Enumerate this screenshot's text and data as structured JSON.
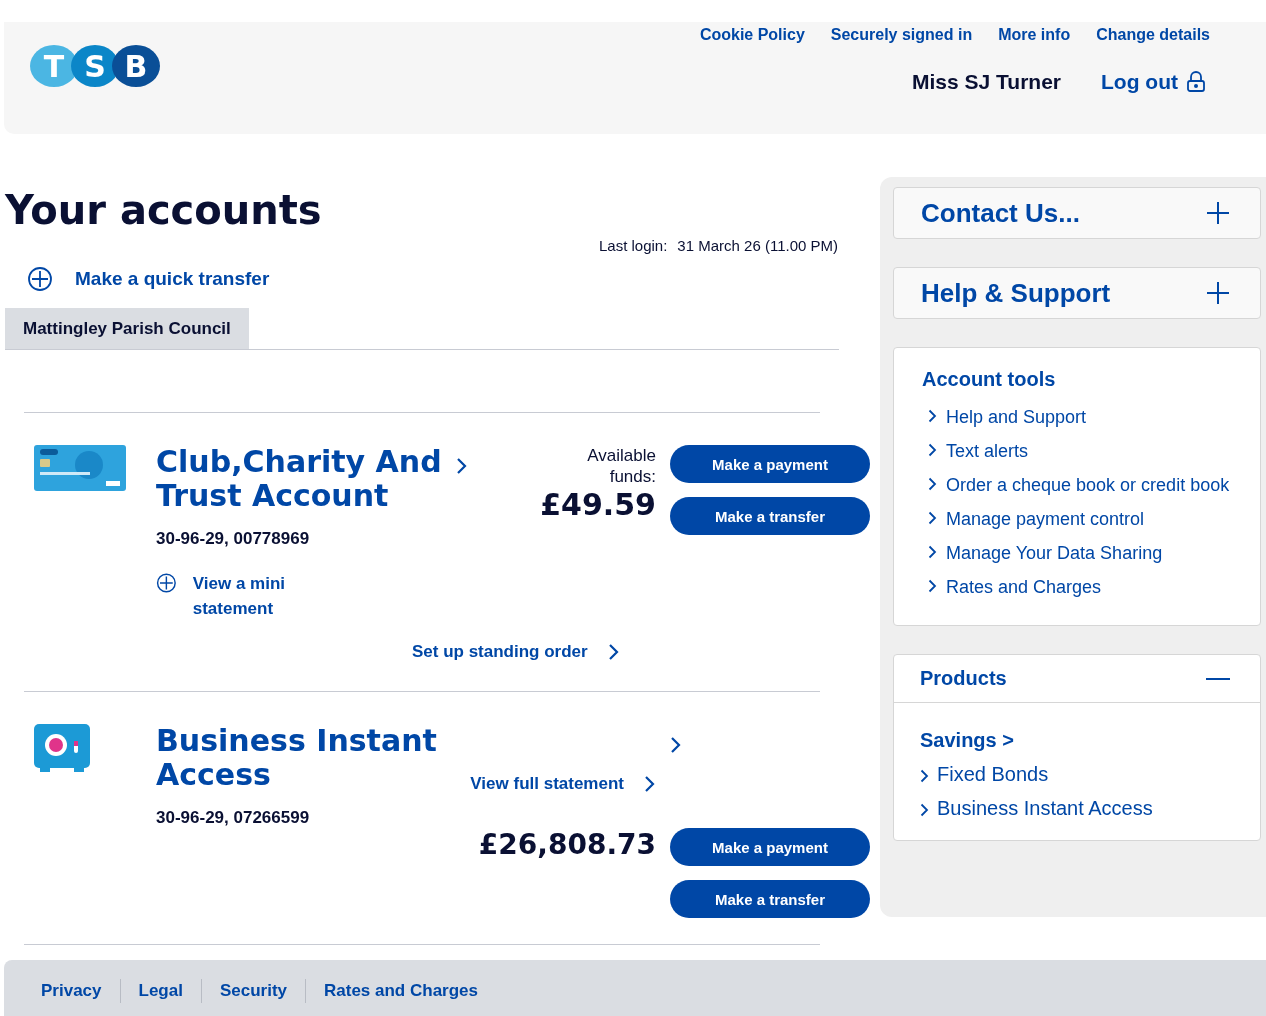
{
  "header": {
    "logo": [
      "T",
      "S",
      "B"
    ],
    "links": [
      "Cookie Policy",
      "Securely signed in",
      "More info",
      "Change details"
    ],
    "user": "Miss SJ Turner",
    "logout": "Log out"
  },
  "title": "Your accounts",
  "last_login": {
    "label": "Last login:",
    "value": "31 March 26 (11.00 PM)"
  },
  "quick_transfer": "Make a quick transfer",
  "tabs": [
    {
      "label": "Mattingley Parish Council",
      "selected": true
    }
  ],
  "accounts": [
    {
      "kind": "card",
      "name": "Club,Charity And Trust Account",
      "number": "30-96-29, 00778969",
      "funds_label": "Available funds:",
      "balance": "£49.59",
      "buttons": [
        "Make a payment",
        "Make a transfer"
      ],
      "mini_link": "View a mini statement",
      "action_link": "Set up standing order"
    },
    {
      "kind": "safe",
      "name": "Business Instant Access",
      "number": "30-96-29, 07266599",
      "balance": "£26,808.73",
      "buttons": [
        "Make a payment",
        "Make a transfer"
      ],
      "action_link": "View full statement"
    }
  ],
  "sidebar": {
    "accordions": [
      {
        "title": "Contact Us...",
        "expanded": false
      },
      {
        "title": "Help & Support",
        "expanded": false
      }
    ],
    "account_tools": {
      "title": "Account tools",
      "items": [
        "Help and Support",
        "Text alerts",
        "Order a cheque book or credit book",
        "Manage payment control",
        "Manage Your Data Sharing",
        "Rates and Charges"
      ]
    },
    "products": {
      "title": "Products",
      "expanded": true,
      "items": [
        {
          "kind": "heading",
          "label": "Savings >"
        },
        {
          "kind": "link",
          "label": "Fixed Bonds"
        },
        {
          "kind": "link",
          "label": "Business Instant Access"
        }
      ]
    }
  },
  "footer": [
    "Privacy",
    "Legal",
    "Security",
    "Rates and Charges"
  ]
}
